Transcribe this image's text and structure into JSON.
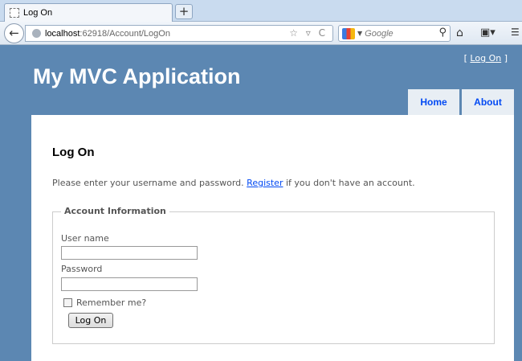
{
  "browser": {
    "tab_title": "Log On",
    "new_tab_symbol": "+",
    "back_symbol": "←",
    "url_host": "localhost",
    "url_path": ":62918/Account/LogOn",
    "url_icons": "☆ ▿ C",
    "search_placeholder": "Google",
    "icons": [
      "back-icon",
      "globe-icon",
      "star-icon",
      "reload-icon",
      "google-icon",
      "search-icon",
      "home-icon",
      "bookmark-icon"
    ]
  },
  "header": {
    "login_prefix": "[ ",
    "login_link": "Log On",
    "login_suffix": " ]",
    "app_title": "My MVC Application",
    "menu": [
      {
        "label": "Home"
      },
      {
        "label": "About"
      }
    ]
  },
  "main": {
    "heading": "Log On",
    "intro_before": "Please enter your username and password. ",
    "intro_link": "Register",
    "intro_after": " if you don't have an account.",
    "fieldset_legend": "Account Information",
    "username_label": "User name",
    "username_value": "",
    "password_label": "Password",
    "password_value": "",
    "remember_label": "Remember me?",
    "submit_label": "Log On"
  },
  "colors": {
    "background": "#5c87b2",
    "link": "#034af3",
    "menu_bg": "#e8eef4"
  }
}
